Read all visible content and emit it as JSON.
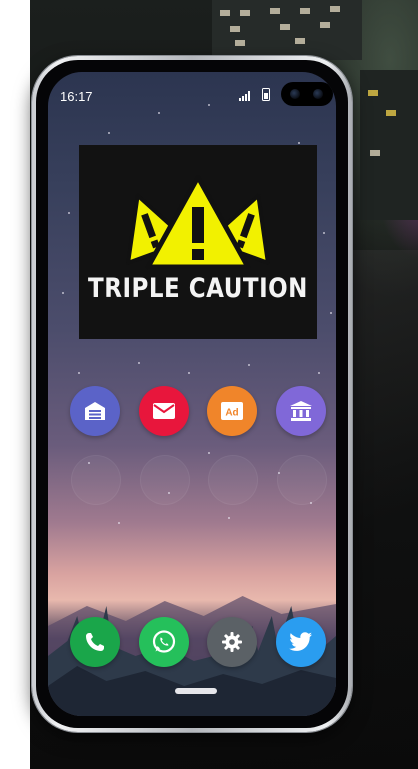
{
  "status_bar": {
    "time": "16:17",
    "signal_icon": "signal-icon",
    "battery_icon": "battery-icon"
  },
  "widget": {
    "text": "TRIPLE CAUTION",
    "icon": "triple-warning-triangles-icon",
    "triangle_color": "#f2f100"
  },
  "apps_row": [
    {
      "name": "garage-app",
      "icon": "garage-icon",
      "color": "#5b63c8"
    },
    {
      "name": "mail-app",
      "icon": "envelope-icon",
      "color": "#e8163c"
    },
    {
      "name": "ad-app",
      "icon": "ad-icon",
      "color": "#f0852a",
      "glyph": "Ad"
    },
    {
      "name": "bank-app",
      "icon": "bank-icon",
      "color": "#8068d8"
    }
  ],
  "dock": [
    {
      "name": "phone-app",
      "icon": "phone-icon",
      "color": "#1aa64a"
    },
    {
      "name": "whatsapp-app",
      "icon": "whatsapp-icon",
      "color": "#25c05b"
    },
    {
      "name": "settings-app",
      "icon": "gear-icon",
      "color": "#5b6166"
    },
    {
      "name": "twitter-app",
      "icon": "bird-icon",
      "color": "#2a9df0"
    }
  ]
}
